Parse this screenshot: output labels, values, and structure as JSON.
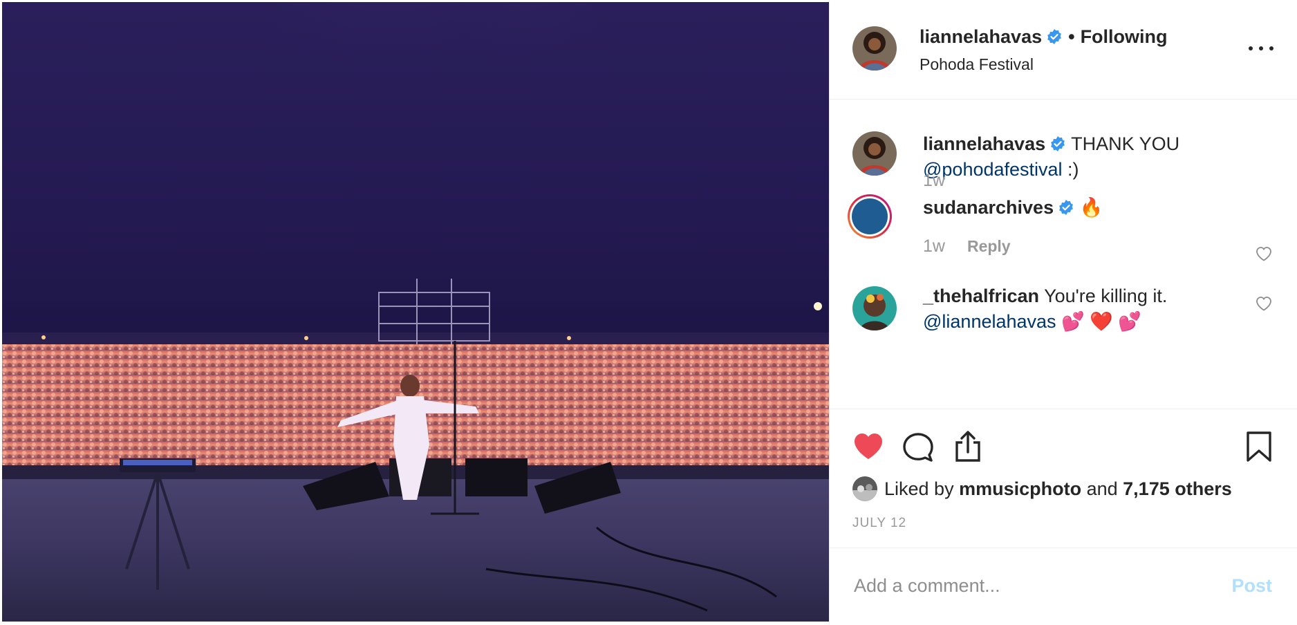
{
  "post": {
    "author": "liannelahavas",
    "follow_separator": "•",
    "follow_status": "Following",
    "location": "Pohoda Festival"
  },
  "comments": [
    {
      "user": "liannelahavas",
      "text": "THANK YOU",
      "mention": "@pohodafestival",
      "after_mention": " :)",
      "time": "1w"
    },
    {
      "user": "sudanarchives",
      "text": "🔥",
      "time": "1w",
      "reply_label": "Reply"
    },
    {
      "user": "_thehalfrican",
      "text": "You're killing it.",
      "mention": "@liannelahavas",
      "after_mention": " 💕 ❤️ 💕"
    }
  ],
  "likes": {
    "prefix": "Liked by ",
    "user": "mmusicphoto",
    "middle": " and ",
    "count": "7,175 others"
  },
  "date": "JULY 12",
  "comment_box": {
    "placeholder": "Add a comment...",
    "post_label": "Post"
  },
  "colors": {
    "like_red": "#ed4956",
    "link_blue": "#003569",
    "verified_blue": "#3897f0",
    "muted": "#999999",
    "post_disabled": "#b2dffc"
  },
  "icons": [
    "verified-badge-icon",
    "more-options-icon",
    "heart-icon",
    "comment-icon",
    "share-icon",
    "bookmark-icon"
  ]
}
